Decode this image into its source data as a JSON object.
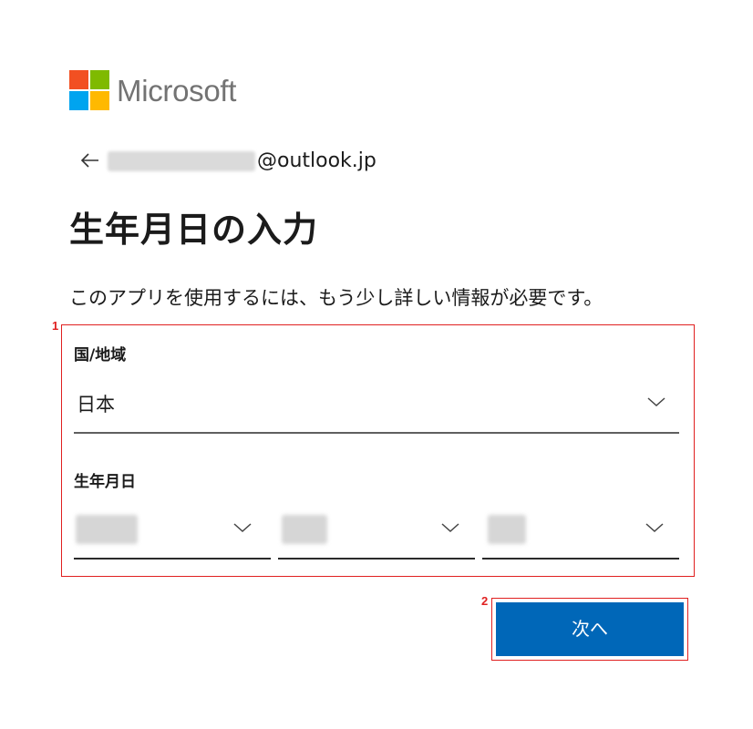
{
  "brand": {
    "name": "Microsoft",
    "logo_colors": [
      "#f25022",
      "#7fba00",
      "#00a4ef",
      "#ffb900"
    ]
  },
  "identity": {
    "back_icon": "arrow-left-icon",
    "email_suffix": "@outlook.jp"
  },
  "heading": "生年月日の入力",
  "description": "このアプリを使用するには、もう少し詳しい情報が必要です。",
  "annotations": {
    "box1": "1",
    "box2": "2",
    "color": "#e02020"
  },
  "country": {
    "label": "国/地域",
    "value": "日本",
    "icon": "chevron-down-icon"
  },
  "birthdate": {
    "label": "生年月日",
    "selects": [
      {
        "name": "year",
        "icon": "chevron-down-icon"
      },
      {
        "name": "month",
        "icon": "chevron-down-icon"
      },
      {
        "name": "day",
        "icon": "chevron-down-icon"
      }
    ]
  },
  "next_button": {
    "label": "次へ",
    "color": "#0067b8"
  }
}
